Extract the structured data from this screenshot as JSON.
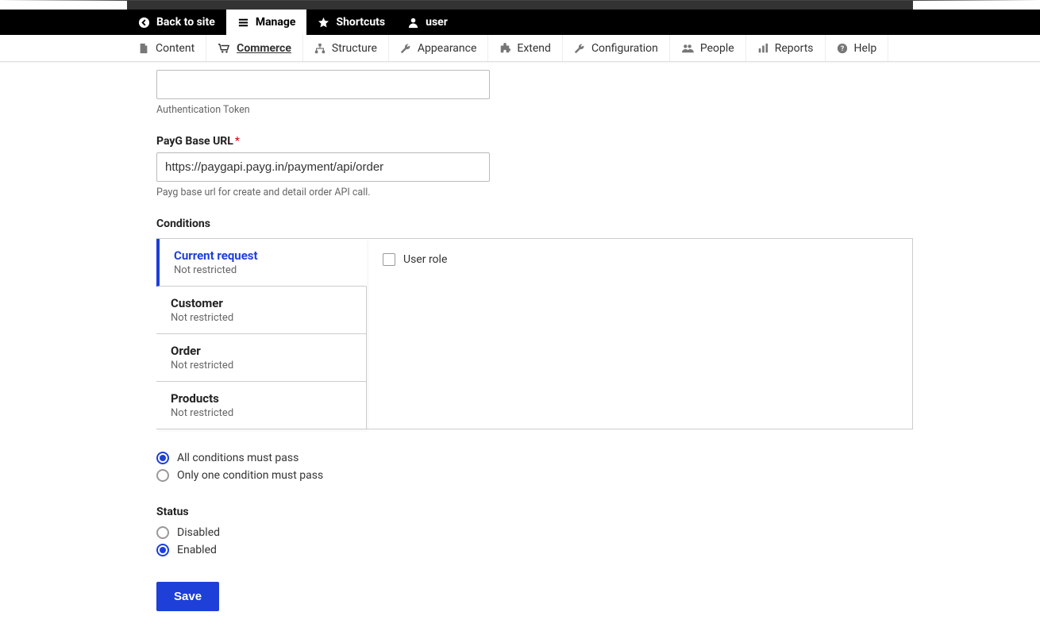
{
  "toolbar": {
    "back": "Back to site",
    "manage": "Manage",
    "shortcuts": "Shortcuts",
    "user": "user"
  },
  "secnav": {
    "content": "Content",
    "commerce": "Commerce",
    "structure": "Structure",
    "appearance": "Appearance",
    "extend": "Extend",
    "configuration": "Configuration",
    "people": "People",
    "reports": "Reports",
    "help": "Help"
  },
  "form": {
    "auth_token_value": "",
    "auth_token_desc": "Authentication Token",
    "base_url_label": "PayG Base URL",
    "base_url_value": "https://paygapi.payg.in/payment/api/order",
    "base_url_desc": "Payg base url for create and detail order API call.",
    "conditions_heading": "Conditions"
  },
  "vtabs": [
    {
      "label": "Current request",
      "sub": "Not restricted"
    },
    {
      "label": "Customer",
      "sub": "Not restricted"
    },
    {
      "label": "Order",
      "sub": "Not restricted"
    },
    {
      "label": "Products",
      "sub": "Not restricted"
    }
  ],
  "panel": {
    "user_role": "User role"
  },
  "condition_logic": {
    "all": "All conditions must pass",
    "one": "Only one condition must pass"
  },
  "status": {
    "heading": "Status",
    "disabled": "Disabled",
    "enabled": "Enabled"
  },
  "actions": {
    "save": "Save"
  }
}
